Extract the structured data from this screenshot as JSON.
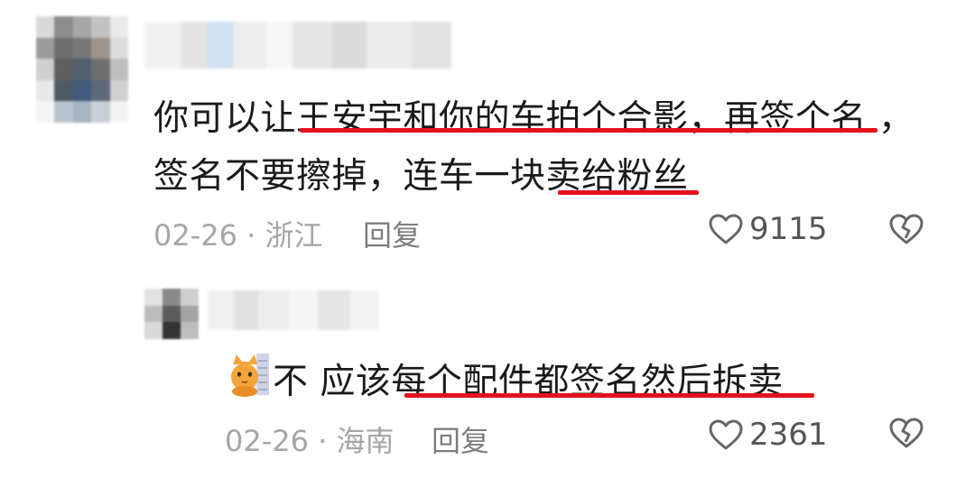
{
  "comment": {
    "text_line1": "你可以让王安宇和你的车拍个合影，再签个名 ，",
    "text_line2": "签名不要擦掉，连车一块卖给粉丝",
    "date_location": "02-26 · 浙江",
    "reply_label": "回复",
    "like_count": "9115",
    "highlight_color": "#e5111c"
  },
  "reply": {
    "text": "不  应该每个配件都签名然后拆卖",
    "date_location": "02-26 · 海南",
    "reply_label": "回复",
    "like_count": "2361"
  },
  "icons": {
    "like": "heart-outline-icon",
    "dislike": "broken-heart-icon",
    "emoji": "cat-emoji-icon"
  }
}
